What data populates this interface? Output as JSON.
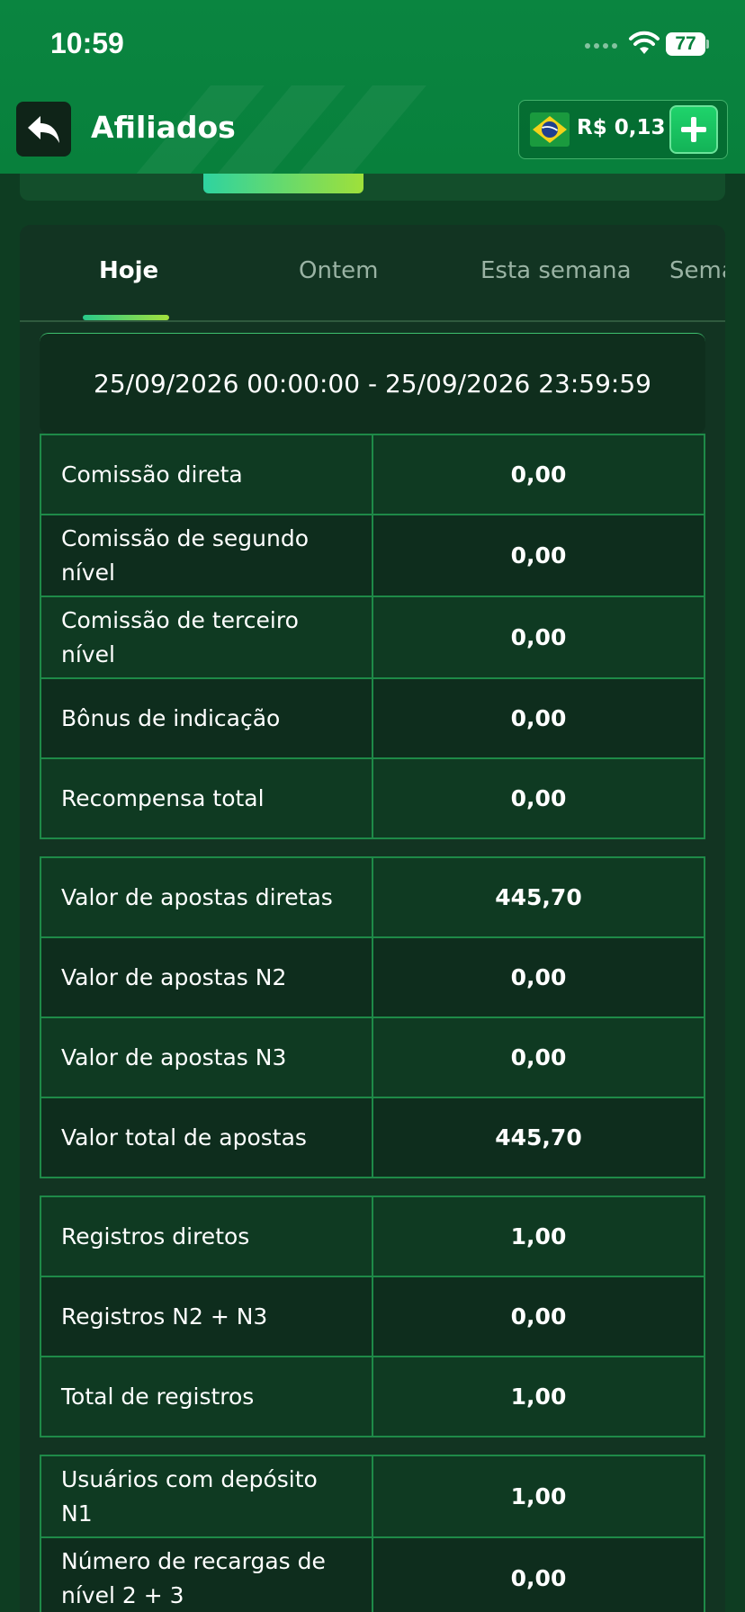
{
  "status_bar": {
    "time": "10:59",
    "battery": "77"
  },
  "header": {
    "title": "Afiliados",
    "balance": "R$ 0,13",
    "flag_icon": "brazil-flag-icon",
    "accent": "#1fd36b"
  },
  "tabs": [
    {
      "label": "Hoje"
    },
    {
      "label": "Ontem"
    },
    {
      "label": "Esta semana"
    },
    {
      "label": "Semana passada"
    }
  ],
  "date_range": "25/09/2026 00:00:00 - 25/09/2026 23:59:59",
  "commission_table": [
    {
      "label": "Comissão direta",
      "value": "0,00"
    },
    {
      "label": "Comissão de segundo nível",
      "value": "0,00"
    },
    {
      "label": "Comissão de terceiro nível",
      "value": "0,00"
    },
    {
      "label": "Bônus de indicação",
      "value": "0,00"
    },
    {
      "label": "Recompensa total",
      "value": "0,00"
    }
  ],
  "bets_table": [
    {
      "label": "Valor de apostas diretas",
      "value": "445,70"
    },
    {
      "label": "Valor de apostas N2",
      "value": "0,00"
    },
    {
      "label": "Valor de apostas N3",
      "value": "0,00"
    },
    {
      "label": "Valor total de apostas",
      "value": "445,70"
    }
  ],
  "registrations_table": [
    {
      "label": "Registros diretos",
      "value": "1,00"
    },
    {
      "label": "Registros N2 + N3",
      "value": "0,00"
    },
    {
      "label": "Total de registros",
      "value": "1,00"
    }
  ],
  "deposits_table": [
    {
      "label": "Usuários com depósito N1",
      "value": "1,00"
    },
    {
      "label": "Número de recargas de nível 2 + 3",
      "value": "0,00"
    }
  ]
}
